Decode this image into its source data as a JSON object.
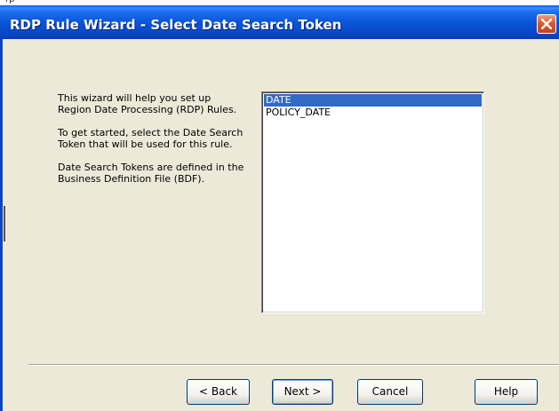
{
  "window": {
    "title": "RDP Rule Wizard - Select Date Search Token"
  },
  "intro": {
    "paragraph1": "This wizard will help you set up Region Date Processing (RDP) Rules.",
    "paragraph2": "To get started, select the Date Search Token that will be used for this rule.",
    "paragraph3": "Date Search Tokens are defined in the Business Definition File (BDF)."
  },
  "token_list": {
    "items": [
      {
        "label": "DATE",
        "selected": true
      },
      {
        "label": "POLICY_DATE",
        "selected": false
      }
    ]
  },
  "buttons": {
    "back": "< Back",
    "next": "Next >",
    "cancel": "Cancel",
    "help": "Help"
  },
  "colors": {
    "titlebar": "#0a55d8",
    "selection": "#316ac5",
    "close_button": "#e0582a",
    "dialog_bg": "#ece9d8"
  },
  "icons": {
    "close": "close-icon"
  }
}
